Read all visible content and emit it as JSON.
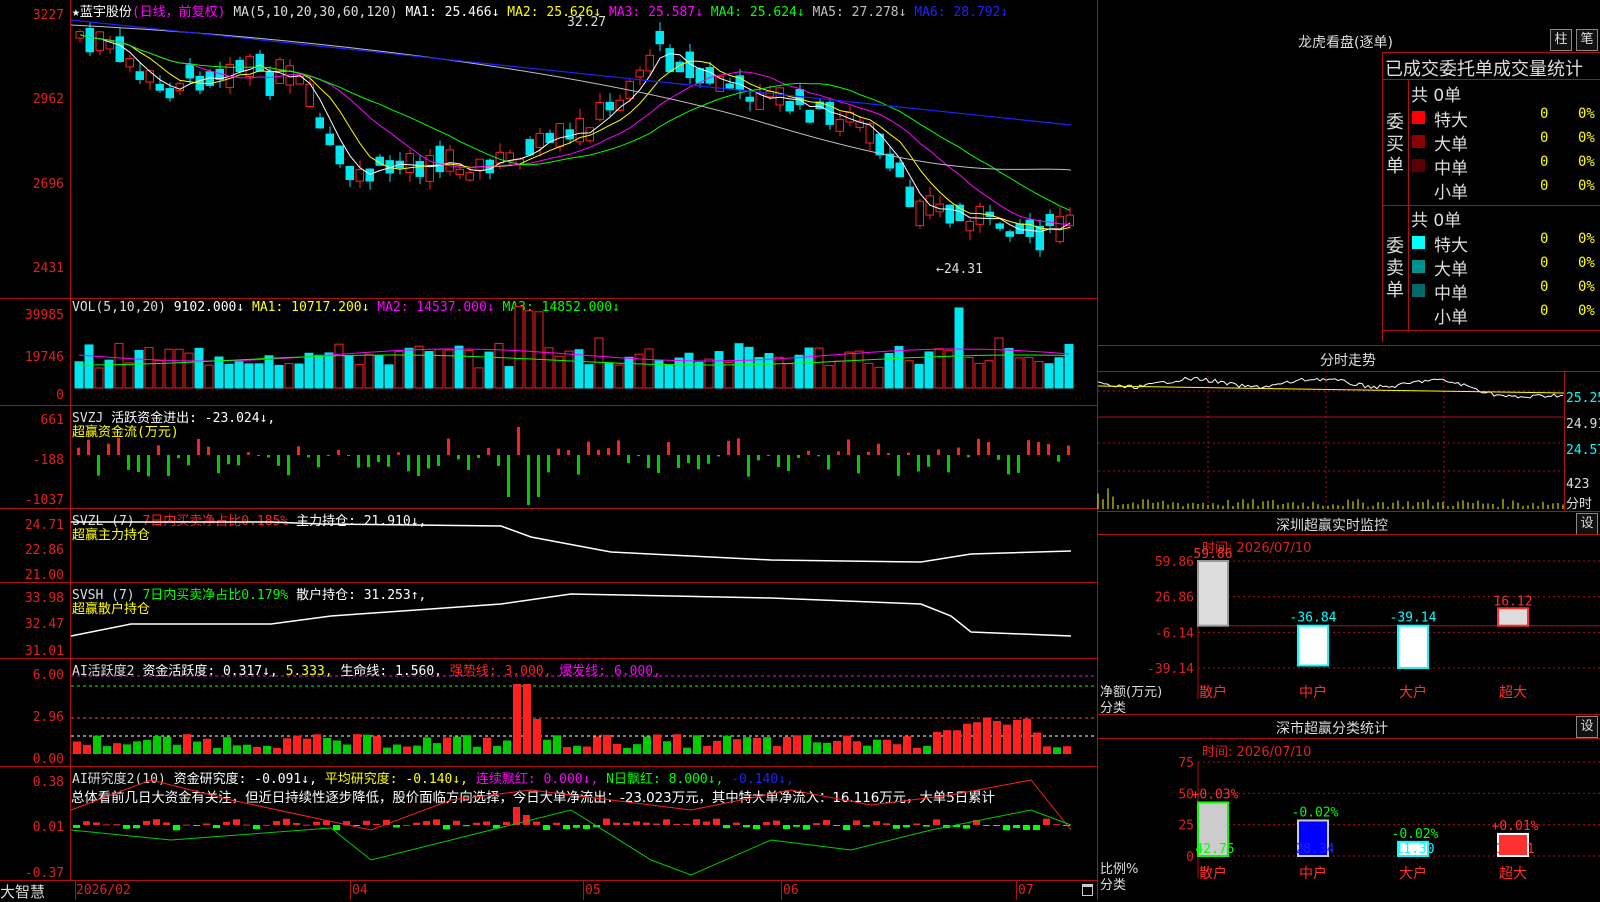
{
  "stock": {
    "name": "蓝宇股份",
    "star": "★",
    "period": "(日线，前复权)"
  },
  "ma_line": {
    "params": "MA(5,10,20,30,60,120)",
    "ma1": "MA1: 25.466↓",
    "ma2": "MA2: 25.626↓",
    "ma3": "MA3: 25.587↓",
    "ma4": "MA4: 25.624↓",
    "ma5": "MA5: 27.278↓",
    "ma6": "MA6: 28.792↓"
  },
  "price_axis": [
    "3227",
    "2962",
    "2696",
    "2431"
  ],
  "price_annotations": {
    "high": "32.27",
    "low": "←24.31"
  },
  "vol": {
    "params": "VOL(5,10,20)",
    "value": "9102.000↓",
    "ma1": "MA1: 10717.200↓",
    "ma2": "MA2: 14537.000↓",
    "ma3": "MA3: 14852.000↓",
    "axis": [
      "39985",
      "19746",
      "0"
    ]
  },
  "svzj": {
    "name": "SVZJ",
    "desc": "活跃资金进出: -23.024↓,",
    "sub": "超赢资金流(万元)",
    "axis": [
      "661",
      "-188",
      "-1037"
    ]
  },
  "svzl": {
    "name": "SVZL (7)",
    "desc1": "7日内买卖净占比0.185%",
    "desc2": "主力持仓: 21.910↓,",
    "sub": "超赢主力持仓",
    "axis": [
      "24.71",
      "22.86",
      "21.00"
    ]
  },
  "svsh": {
    "name": "SVSH (7)",
    "desc1": "7日内买卖净占比0.179%",
    "desc2": "散户持仓: 31.253↑,",
    "sub": "超赢散户持仓",
    "axis": [
      "33.98",
      "32.47",
      "31.01"
    ]
  },
  "ai2": {
    "name": "AI活跃度2",
    "v1": "资金活跃度: 0.317↓,",
    "v2": "5.333,",
    "v3": "生命线: 1.560,",
    "v4": "强势线: 3.000,",
    "v5": "爆发线: 6.000,",
    "axis": [
      "6.00",
      "2.96",
      "0.00"
    ]
  },
  "ai_research": {
    "name": "AI研究度2(10)",
    "v1": "资金研究度: -0.091↓,",
    "v2": "平均研究度: -0.140↓,",
    "v3": "连续飘红: 0.000↓,",
    "v4": "N日飘红: 8.000↓,",
    "v5": "-0.140↓,",
    "commentary": "总体看前几日大资金有关注，但近日持续性逐步降低，股价面临方向选择，今日大单净流出：-23.023万元，其中特大单净流入：16.116万元，大单5日累计",
    "axis": [
      "0.38",
      "0.01",
      "-0.37"
    ]
  },
  "date_axis": [
    "2026/02",
    "04",
    "05",
    "06",
    "07"
  ],
  "brand": "大智慧",
  "dragon_tiger": {
    "title": "龙虎看盘(逐单)",
    "btn_zhu": "柱",
    "btn_bi": "笔",
    "header": "已成交委托单成交量统计",
    "buy_label": "委买单",
    "sell_label": "委卖单",
    "buy_total": "共 0单",
    "sell_total": "共 0单",
    "buy_rows": [
      {
        "name": "特大",
        "count": "0",
        "pct": "0%",
        "color": "#ff0000"
      },
      {
        "name": "大单",
        "count": "0",
        "pct": "0%",
        "color": "#8b0000"
      },
      {
        "name": "中单",
        "count": "0",
        "pct": "0%",
        "color": "#5a0000"
      },
      {
        "name": "小单",
        "count": "0",
        "pct": "0%",
        "color": "#000000"
      }
    ],
    "sell_rows": [
      {
        "name": "特大",
        "count": "0",
        "pct": "0%",
        "color": "#00ffff"
      },
      {
        "name": "大单",
        "count": "0",
        "pct": "0%",
        "color": "#009090"
      },
      {
        "name": "中单",
        "count": "0",
        "pct": "0%",
        "color": "#006a6a"
      },
      {
        "name": "小单",
        "count": "0",
        "pct": "0%",
        "color": "#000000"
      }
    ]
  },
  "intraday": {
    "title": "分时走势",
    "axis": [
      "25.25",
      "24.91",
      "24.57"
    ],
    "vol_label": "423",
    "vol_unit": "分时"
  },
  "sz_monitor": {
    "title": "深圳超赢实时监控",
    "btn": "设",
    "time": "时间: 2026/07/10",
    "axis": [
      "59.86",
      "26.86",
      "-6.14",
      "-39.14"
    ],
    "ylabel": "净额(万元)",
    "xlabel": "分类",
    "bars": [
      {
        "cat": "散户",
        "value": "59.86"
      },
      {
        "cat": "中户",
        "value": "-36.84"
      },
      {
        "cat": "大户",
        "value": "-39.14"
      },
      {
        "cat": "超大",
        "value": "16.12"
      }
    ]
  },
  "sz_class": {
    "title": "深市超赢分类统计",
    "btn": "设",
    "time": "时间: 2026/07/10",
    "axis": [
      "75",
      "50",
      "25",
      "0"
    ],
    "ylabel": "比例%",
    "xlabel": "分类",
    "bars": [
      {
        "cat": "散户",
        "value": "42.75",
        "delta": "+0.03%"
      },
      {
        "cat": "中户",
        "value": "28.34",
        "delta": "-0.02%"
      },
      {
        "cat": "大户",
        "value": "11.30",
        "delta": "-0.02%"
      },
      {
        "cat": "超大",
        "value": "17.61",
        "delta": "+0.01%"
      }
    ]
  },
  "chart_data": [
    {
      "type": "bar",
      "title": "深圳超赢实时监控",
      "categories": [
        "散户",
        "中户",
        "大户",
        "超大"
      ],
      "values": [
        59.86,
        -36.84,
        -39.14,
        16.12
      ],
      "ylabel": "净额(万元)",
      "xlabel": "分类",
      "ylim": [
        -39.14,
        59.86
      ]
    },
    {
      "type": "bar",
      "title": "深市超赢分类统计",
      "categories": [
        "散户",
        "中户",
        "大户",
        "超大"
      ],
      "values": [
        42.75,
        28.34,
        11.3,
        17.61
      ],
      "ylabel": "比例%",
      "xlabel": "分类",
      "ylim": [
        0,
        75
      ]
    }
  ],
  "colors": {
    "up": "#ff2020",
    "down": "#00e5ee",
    "grid": "#b01010",
    "ma1": "#ffffff",
    "ma2": "#ffff00",
    "ma3": "#ff00ff",
    "ma4": "#00ff00",
    "ma5": "#c0c0c0",
    "ma6": "#2020ff"
  }
}
